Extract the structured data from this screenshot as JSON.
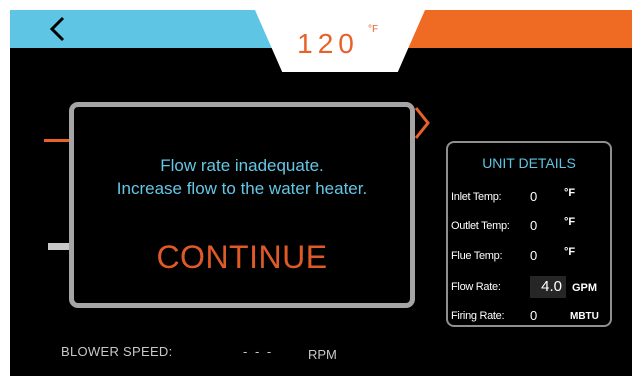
{
  "header": {
    "temperature": "120",
    "temperature_unit": "°F",
    "back_icon": "chevron-left-icon"
  },
  "modal": {
    "line1": "Flow rate inadequate.",
    "line2": "Increase flow to the water heater.",
    "continue_label": "CONTINUE"
  },
  "unit_details": {
    "title": "UNIT DETAILS",
    "rows": [
      {
        "label": "Inlet Temp:",
        "value": "0",
        "unit": "°F"
      },
      {
        "label": "Outlet Temp:",
        "value": "0",
        "unit": "°F"
      },
      {
        "label": "Flue Temp:",
        "value": "0",
        "unit": "°F"
      },
      {
        "label": "Flow Rate:",
        "value": "4.0",
        "unit": "GPM"
      },
      {
        "label": "Firing Rate:",
        "value": "0",
        "unit": "MBTU"
      }
    ]
  },
  "blower": {
    "label": "BLOWER SPEED:",
    "value": "- - -",
    "unit": "RPM"
  },
  "colors": {
    "banner_left": "#5ec6e4",
    "banner_right": "#ef6a22",
    "accent_orange": "#e8612a",
    "accent_blue": "#63c7e6"
  }
}
